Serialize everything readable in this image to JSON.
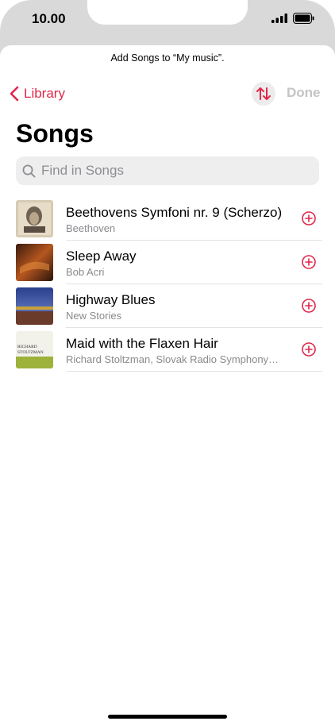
{
  "status_bar": {
    "time": "10.00"
  },
  "sheet": {
    "prompt": "Add Songs to “My music”."
  },
  "nav": {
    "back_label": "Library",
    "done_label": "Done"
  },
  "page": {
    "title": "Songs"
  },
  "search": {
    "placeholder": "Find in Songs",
    "value": ""
  },
  "songs": [
    {
      "title": "Beethovens Symfoni nr. 9 (Scherzo)",
      "artist": "Beethoven"
    },
    {
      "title": "Sleep Away",
      "artist": "Bob Acri"
    },
    {
      "title": "Highway Blues",
      "artist": "New Stories"
    },
    {
      "title": "Maid with the Flaxen Hair",
      "artist": "Richard Stoltzman, Slovak Radio Symphony…"
    }
  ],
  "album_art_text": {
    "song4_line1": "RICHARD",
    "song4_line2": "STOLTZMAN"
  },
  "colors": {
    "accent": "#e0284a",
    "disabled": "#c4c4c6",
    "secondary_text": "#8a8a8e"
  },
  "icons": {
    "back": "chevron-left-icon",
    "sort": "sort-arrows-icon",
    "search": "magnifier-icon",
    "add": "plus-circle-icon"
  }
}
